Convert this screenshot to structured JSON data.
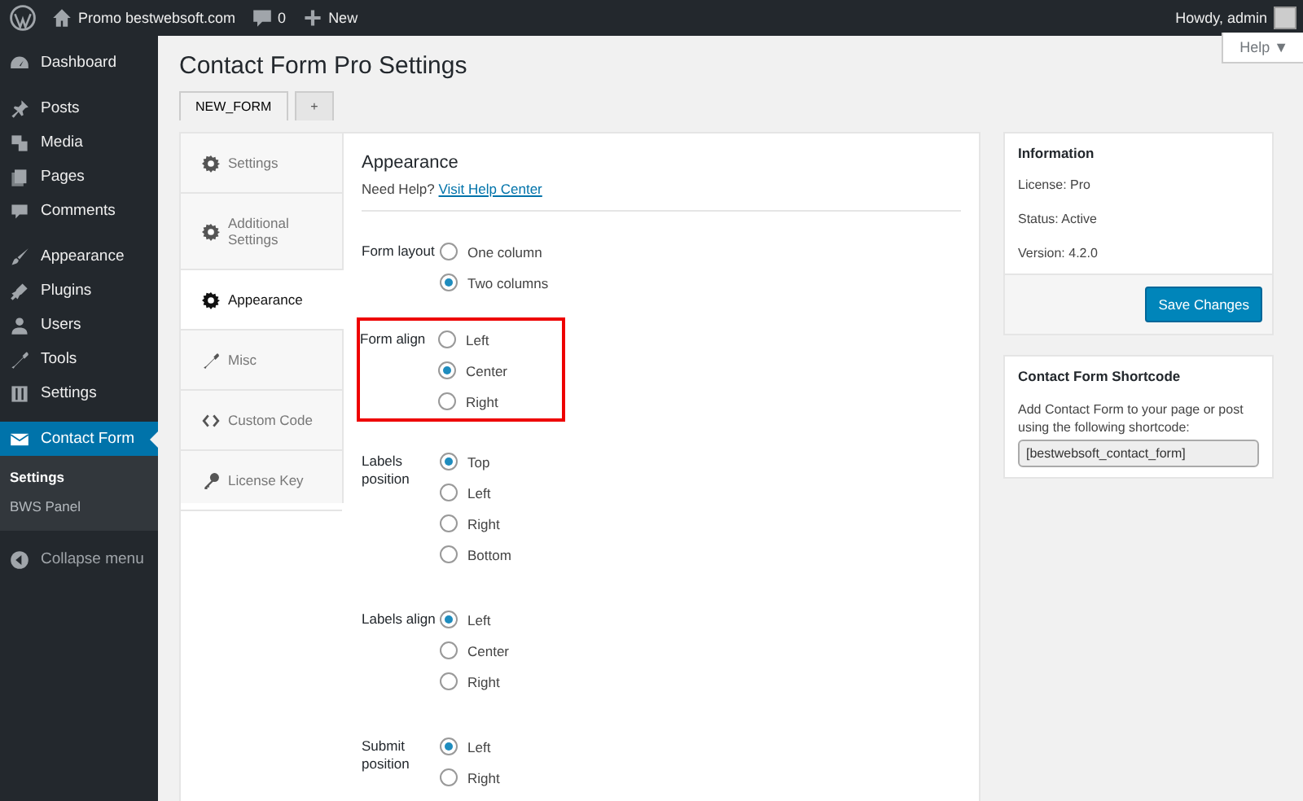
{
  "admin_bar": {
    "site": "Promo bestwebsoft.com",
    "comments": "0",
    "new": "New",
    "greeting": "Howdy, admin"
  },
  "sidebar": {
    "groups": [
      [
        {
          "label": "Dashboard",
          "selected": false
        }
      ],
      [
        {
          "label": "Posts",
          "selected": false
        },
        {
          "label": "Media",
          "selected": false
        },
        {
          "label": "Pages",
          "selected": false
        },
        {
          "label": "Comments",
          "selected": false
        }
      ],
      [
        {
          "label": "Appearance",
          "selected": false
        },
        {
          "label": "Plugins",
          "selected": false
        },
        {
          "label": "Users",
          "selected": false
        },
        {
          "label": "Tools",
          "selected": false
        },
        {
          "label": "Settings",
          "selected": false
        }
      ],
      [
        {
          "label": "Contact Form",
          "selected": true
        }
      ]
    ],
    "submenu": [
      {
        "label": "Settings",
        "selected": true
      },
      {
        "label": "BWS Panel",
        "selected": false
      }
    ],
    "collapse": "Collapse menu"
  },
  "help_button": "Help ▼",
  "page_title": "Contact Form Pro Settings",
  "form_tabs": [
    {
      "label": "NEW_FORM",
      "selected": true
    },
    {
      "label": "+",
      "selected": false
    }
  ],
  "settings_nav": [
    {
      "label": "Settings",
      "selected": false
    },
    {
      "label": "Additional Settings",
      "selected": false
    },
    {
      "label": "Appearance",
      "selected": true
    },
    {
      "label": "Misc",
      "selected": false
    },
    {
      "label": "Custom Code",
      "selected": false
    },
    {
      "label": "License Key",
      "selected": false
    }
  ],
  "panel": {
    "heading": "Appearance",
    "help_prefix": "Need Help?",
    "help_link": "Visit Help Center",
    "rows": [
      {
        "label": "Form layout",
        "highlighted": false,
        "options": [
          {
            "label": "One column",
            "selected": false
          },
          {
            "label": "Two columns",
            "selected": true
          }
        ]
      },
      {
        "label": "Form align",
        "highlighted": true,
        "options": [
          {
            "label": "Left",
            "selected": false
          },
          {
            "label": "Center",
            "selected": true
          },
          {
            "label": "Right",
            "selected": false
          }
        ]
      },
      {
        "label": "Labels position",
        "highlighted": false,
        "options": [
          {
            "label": "Top",
            "selected": true
          },
          {
            "label": "Left",
            "selected": false
          },
          {
            "label": "Right",
            "selected": false
          },
          {
            "label": "Bottom",
            "selected": false
          }
        ]
      },
      {
        "label": "Labels align",
        "highlighted": false,
        "options": [
          {
            "label": "Left",
            "selected": true
          },
          {
            "label": "Center",
            "selected": false
          },
          {
            "label": "Right",
            "selected": false
          }
        ]
      },
      {
        "label": "Submit position",
        "highlighted": false,
        "options": [
          {
            "label": "Left",
            "selected": true
          },
          {
            "label": "Right",
            "selected": false
          }
        ]
      }
    ]
  },
  "information": {
    "title": "Information",
    "lines": [
      "License: Pro",
      "Status: Active",
      "Version: 4.2.0"
    ],
    "button": "Save Changes"
  },
  "shortcode": {
    "title": "Contact Form Shortcode",
    "text": "Add Contact Form to your page or post using the following shortcode:",
    "value": "[bestwebsoft_contact_form]"
  }
}
